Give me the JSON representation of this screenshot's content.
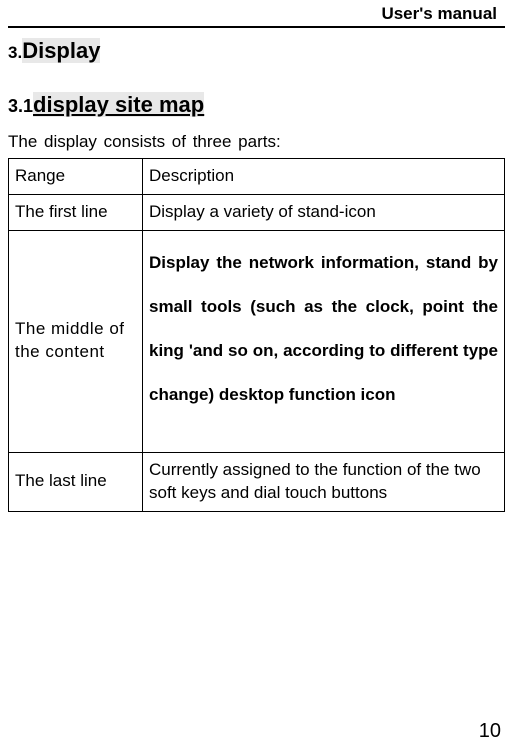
{
  "header": "User's manual",
  "section": {
    "num": "3.",
    "text": "Display"
  },
  "subsection": {
    "num": "3.1",
    "text": "display site  map"
  },
  "intro": "The  display consists  of  three  parts:",
  "table": {
    "head": {
      "range": "Range",
      "desc": "Description"
    },
    "rows": [
      {
        "range": "The  first  line",
        "desc": "Display  a  variety  of stand-icon"
      },
      {
        "range": "The  middle  of the  content",
        "desc": "Display the network information, stand by small tools (such as the clock, point the king 'and so on, according to different type change) desktop function icon"
      },
      {
        "range": "The  last  line",
        "desc": "Currently  assigned  to  the function of the  two  soft  keys and dial touch buttons"
      }
    ]
  },
  "page_number": "10"
}
